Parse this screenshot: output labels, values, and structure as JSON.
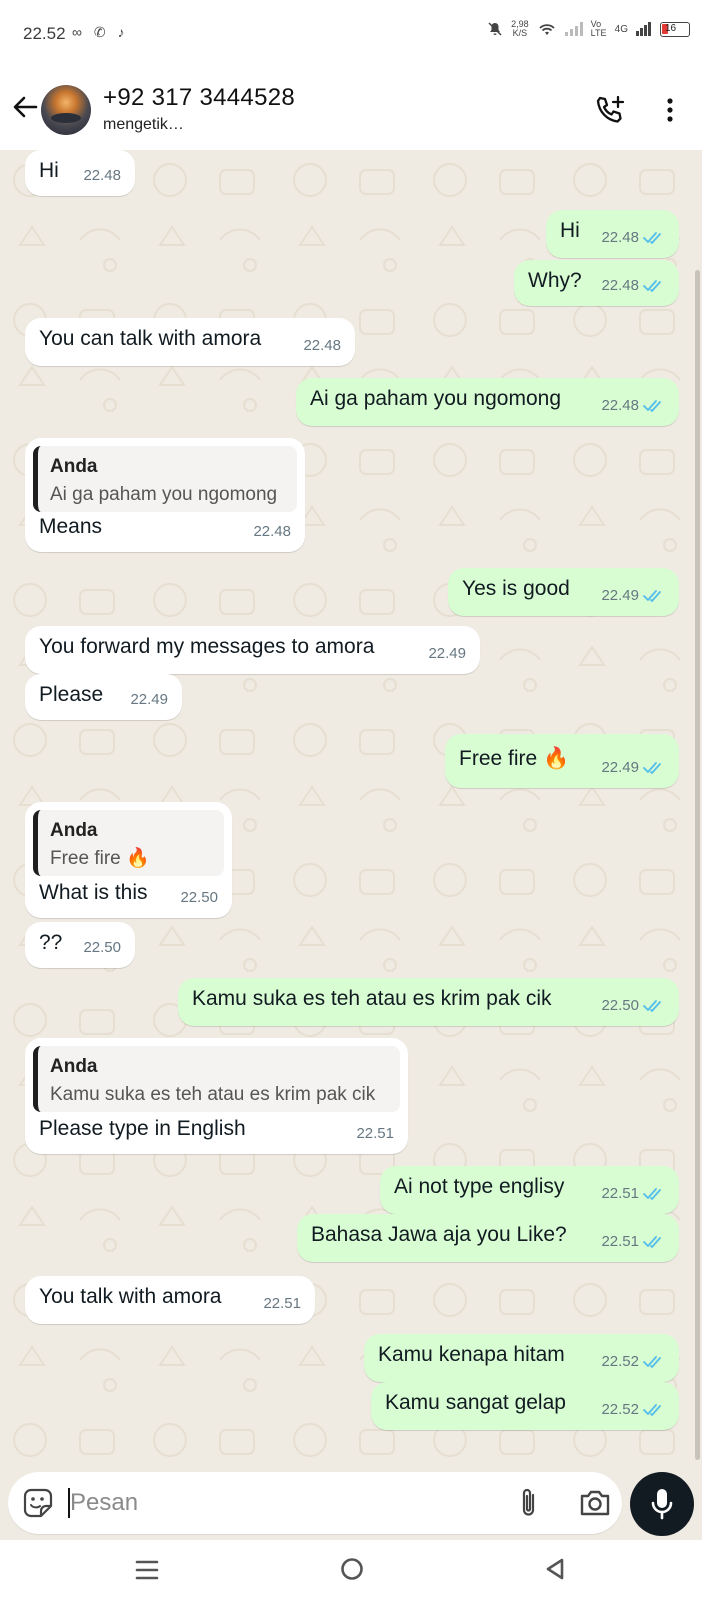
{
  "status_bar": {
    "time": "22.52",
    "speed_value": "2,98",
    "speed_unit": "K/S",
    "volte_label": "Vo LTE",
    "network_label": "4G",
    "battery_level": "16",
    "left_icons": "∞ ✆ ♪"
  },
  "header": {
    "contact_name": "+92 317 3444528",
    "status": "mengetik…"
  },
  "messages": [
    {
      "dir": "in",
      "text": "Hi",
      "time": "22.48"
    },
    {
      "dir": "out",
      "text": "Hi",
      "time": "22.48",
      "ticks": "read"
    },
    {
      "dir": "out",
      "text": "Why?",
      "time": "22.48",
      "ticks": "read"
    },
    {
      "dir": "in",
      "text": "You can talk with amora",
      "time": "22.48"
    },
    {
      "dir": "out",
      "text": "Ai ga paham you ngomong",
      "time": "22.48",
      "ticks": "read"
    },
    {
      "dir": "in",
      "quote_author": "Anda",
      "quote_text": "Ai ga paham you ngomong",
      "text": "Means",
      "time": "22.48"
    },
    {
      "dir": "out",
      "text": "Yes is good",
      "time": "22.49",
      "ticks": "read"
    },
    {
      "dir": "in",
      "text": "You forward my messages to amora",
      "time": "22.49"
    },
    {
      "dir": "in",
      "text": "Please",
      "time": "22.49"
    },
    {
      "dir": "out",
      "text": "Free fire 🔥",
      "time": "22.49",
      "ticks": "read"
    },
    {
      "dir": "in",
      "quote_author": "Anda",
      "quote_text": "Free fire 🔥",
      "text": "What is this",
      "time": "22.50"
    },
    {
      "dir": "in",
      "text": "??",
      "time": "22.50"
    },
    {
      "dir": "out",
      "text": "Kamu suka es teh atau es krim pak cik",
      "time": "22.50",
      "ticks": "read"
    },
    {
      "dir": "in",
      "quote_author": "Anda",
      "quote_text": "Kamu suka es teh atau es krim pak cik",
      "text": "Please type in English",
      "time": "22.51"
    },
    {
      "dir": "out",
      "text": "Ai not type englisy",
      "time": "22.51",
      "ticks": "read"
    },
    {
      "dir": "out",
      "text": "Bahasa Jawa aja you Like?",
      "time": "22.51",
      "ticks": "read"
    },
    {
      "dir": "in",
      "text": "You talk with amora",
      "time": "22.51"
    },
    {
      "dir": "out",
      "text": "Kamu kenapa hitam",
      "time": "22.52",
      "ticks": "read"
    },
    {
      "dir": "out",
      "text": "Kamu sangat gelap",
      "time": "22.52",
      "ticks": "read"
    }
  ],
  "input": {
    "placeholder": "Pesan"
  },
  "colors": {
    "chat_background": "#efeae2",
    "incoming_bubble": "#ffffff",
    "outgoing_bubble": "#d9fdd3",
    "read_tick": "#53bdeb",
    "mic_button": "#111b21"
  },
  "icons": {
    "header": [
      "back-arrow-icon",
      "add-call-icon",
      "more-vert-icon"
    ],
    "input": [
      "emoji-icon",
      "attach-icon",
      "camera-icon",
      "mic-icon"
    ],
    "navbar": [
      "recent-apps-icon",
      "home-icon",
      "back-icon"
    ]
  }
}
